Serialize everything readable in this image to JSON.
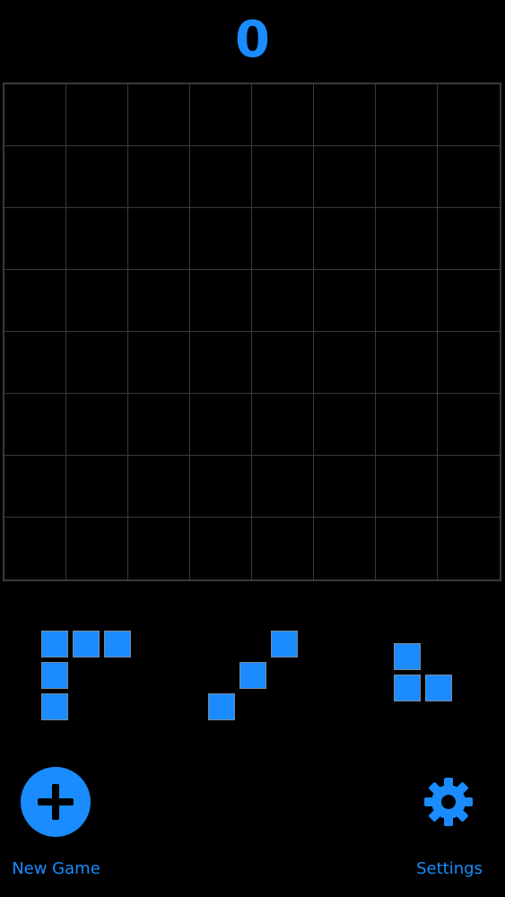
{
  "score": "0",
  "board": {
    "rows": 8,
    "cols": 8,
    "filled_cells": []
  },
  "pieces": [
    {
      "name": "L-corner",
      "cells": [
        [
          0,
          0
        ],
        [
          0,
          1
        ],
        [
          0,
          2
        ],
        [
          1,
          0
        ],
        [
          2,
          0
        ]
      ]
    },
    {
      "name": "diagonal",
      "cells": [
        [
          0,
          2
        ],
        [
          1,
          1
        ],
        [
          2,
          0
        ]
      ]
    },
    {
      "name": "small-L",
      "cells": [
        [
          0,
          0
        ],
        [
          1,
          0
        ],
        [
          1,
          1
        ]
      ]
    }
  ],
  "controls": {
    "new_game_label": "New Game",
    "settings_label": "Settings"
  },
  "colors": {
    "accent": "#1a8cff",
    "background": "#000000",
    "grid_line": "#3a3a3a"
  },
  "icons": {
    "new_game": "plus-icon",
    "settings": "gear-icon"
  }
}
